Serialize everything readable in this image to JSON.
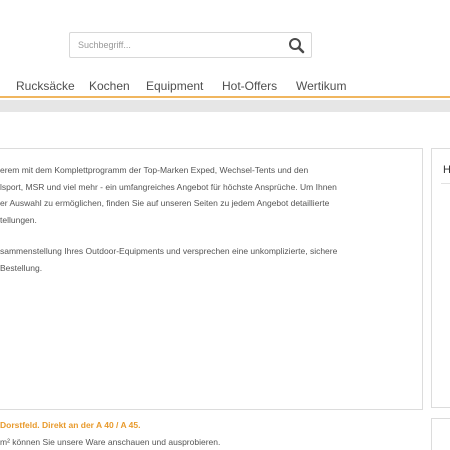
{
  "search": {
    "placeholder": "Suchbegriff..."
  },
  "nav": {
    "items": [
      {
        "label": "Rucksäcke"
      },
      {
        "label": "Kochen"
      },
      {
        "label": "Equipment"
      },
      {
        "label": "Hot-Offers"
      },
      {
        "label": "Wertikum"
      }
    ]
  },
  "main": {
    "paragraph1": [
      "erem mit dem Komplettprogramm der Top-Marken Exped, Wechsel-Tents und den",
      "lsport, MSR und viel mehr - ein umfangreiches Angebot für höchste Ansprüche. Um Ihnen",
      "er Auswahl zu ermöglichen, finden Sie auf unseren Seiten zu jedem Angebot detaillierte",
      "tellungen."
    ],
    "paragraph2": [
      "sammenstellung Ihres Outdoor-Equipments und versprechen eine unkomplizierte, sichere",
      "Bestellung."
    ],
    "location_heading": "Dorstfeld. Direkt an der A 40 / A 45.",
    "location_text": "m² können Sie unsere Ware anschauen und ausprobieren."
  },
  "sidebar": {
    "title": "H"
  },
  "colors": {
    "accent": "#f0b65f",
    "highlight_text": "#e89a2c",
    "border": "#dcdcdc",
    "sub_bar": "#e6e6e6"
  },
  "icons": {
    "search": "search-icon"
  }
}
